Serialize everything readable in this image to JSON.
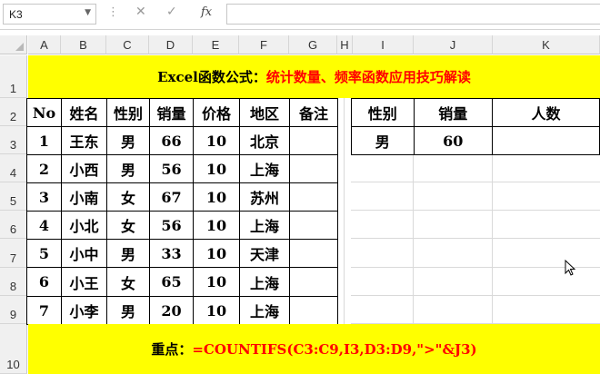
{
  "formula_bar": {
    "name_box": "K3",
    "fx_label": "fx",
    "cancel_symbol": "✕",
    "enter_symbol": "✓",
    "formula": ""
  },
  "columns": [
    "A",
    "B",
    "C",
    "D",
    "E",
    "F",
    "G",
    "H",
    "I",
    "J",
    "K"
  ],
  "rows": [
    "1",
    "2",
    "3",
    "4",
    "5",
    "6",
    "7",
    "8",
    "9",
    "10"
  ],
  "title": {
    "part1": "Excel函数公式：",
    "part2": "统计数量、频率函数应用技巧解读",
    "color_part1": "#000000",
    "color_part2": "#ff0000",
    "background": "#ffff00"
  },
  "table": {
    "headers": [
      "No",
      "姓名",
      "性别",
      "销量",
      "价格",
      "地区",
      "备注"
    ],
    "rows": [
      [
        "1",
        "王东",
        "男",
        "66",
        "10",
        "北京",
        ""
      ],
      [
        "2",
        "小西",
        "男",
        "56",
        "10",
        "上海",
        ""
      ],
      [
        "3",
        "小南",
        "女",
        "67",
        "10",
        "苏州",
        ""
      ],
      [
        "4",
        "小北",
        "女",
        "56",
        "10",
        "上海",
        ""
      ],
      [
        "5",
        "小中",
        "男",
        "33",
        "10",
        "天津",
        ""
      ],
      [
        "6",
        "小王",
        "女",
        "65",
        "10",
        "上海",
        ""
      ],
      [
        "7",
        "小李",
        "男",
        "20",
        "10",
        "上海",
        ""
      ]
    ]
  },
  "criteria": {
    "headers": [
      "性别",
      "销量",
      "人数"
    ],
    "values": [
      "男",
      "60",
      ""
    ]
  },
  "footer": {
    "label": "重点：",
    "formula": "=COUNTIFS(C3:C9,I3,D3:D9,\">\"&J3)",
    "color_label": "#000000",
    "color_formula": "#ff0000",
    "background": "#ffff00"
  }
}
